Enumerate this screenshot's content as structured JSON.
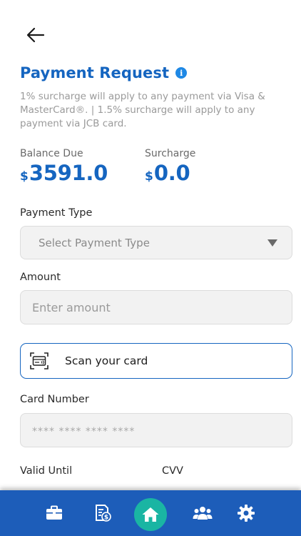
{
  "header": {
    "back_icon": "arrow-left-icon",
    "title": "Payment Request",
    "info_icon": "info-icon",
    "info_glyph": "i",
    "notice": "1% surcharge will apply to any payment via Visa & MasterCard®. | 1.5% surcharge will apply to any payment via JCB card."
  },
  "balance": {
    "label": "Balance Due",
    "currency": "$",
    "amount": "3591.0"
  },
  "surcharge": {
    "label": "Surcharge",
    "currency": "$",
    "amount": "0.0"
  },
  "payment_type": {
    "label": "Payment Type",
    "selected": "Select Payment Type"
  },
  "amount": {
    "label": "Amount",
    "placeholder": "Enter amount",
    "value": ""
  },
  "scan": {
    "label": "Scan your card",
    "icon": "card-scan-icon"
  },
  "card_number": {
    "label": "Card Number",
    "placeholder": "**** **** **** ****",
    "value": ""
  },
  "valid_until": {
    "label": "Valid Until"
  },
  "cvv": {
    "label": "CVV"
  },
  "nav": {
    "items": [
      {
        "icon": "briefcase-icon"
      },
      {
        "icon": "invoice-icon"
      },
      {
        "icon": "home-icon",
        "active": true
      },
      {
        "icon": "team-icon"
      },
      {
        "icon": "settings-icon"
      }
    ]
  },
  "colors": {
    "primary": "#1565c0",
    "nav_bg": "#1d5db9",
    "home_accent": "#1ab5a3",
    "muted": "#9a9a9a"
  }
}
